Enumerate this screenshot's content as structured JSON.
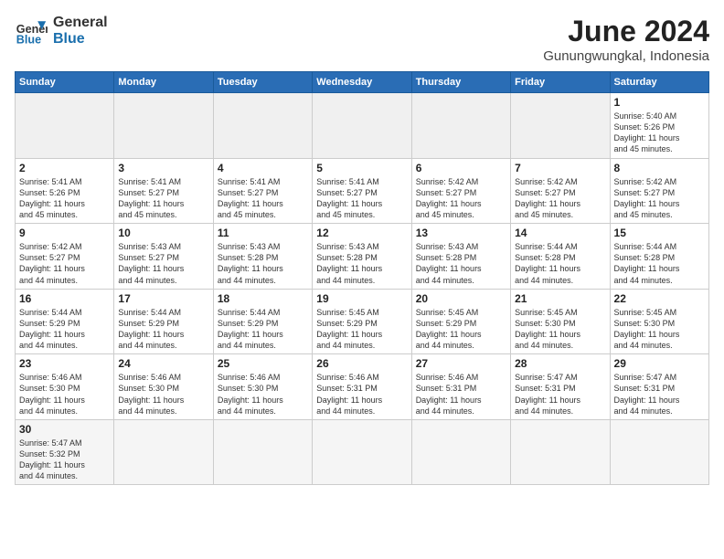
{
  "logo": {
    "line1": "General",
    "line2": "Blue"
  },
  "title": "June 2024",
  "subtitle": "Gunungwungkal, Indonesia",
  "days_of_week": [
    "Sunday",
    "Monday",
    "Tuesday",
    "Wednesday",
    "Thursday",
    "Friday",
    "Saturday"
  ],
  "weeks": [
    [
      {
        "day": "",
        "info": ""
      },
      {
        "day": "",
        "info": ""
      },
      {
        "day": "",
        "info": ""
      },
      {
        "day": "",
        "info": ""
      },
      {
        "day": "",
        "info": ""
      },
      {
        "day": "",
        "info": ""
      },
      {
        "day": "1",
        "info": "Sunrise: 5:40 AM\nSunset: 5:26 PM\nDaylight: 11 hours\nand 45 minutes."
      }
    ],
    [
      {
        "day": "2",
        "info": "Sunrise: 5:41 AM\nSunset: 5:26 PM\nDaylight: 11 hours\nand 45 minutes."
      },
      {
        "day": "3",
        "info": "Sunrise: 5:41 AM\nSunset: 5:27 PM\nDaylight: 11 hours\nand 45 minutes."
      },
      {
        "day": "4",
        "info": "Sunrise: 5:41 AM\nSunset: 5:27 PM\nDaylight: 11 hours\nand 45 minutes."
      },
      {
        "day": "5",
        "info": "Sunrise: 5:41 AM\nSunset: 5:27 PM\nDaylight: 11 hours\nand 45 minutes."
      },
      {
        "day": "6",
        "info": "Sunrise: 5:42 AM\nSunset: 5:27 PM\nDaylight: 11 hours\nand 45 minutes."
      },
      {
        "day": "7",
        "info": "Sunrise: 5:42 AM\nSunset: 5:27 PM\nDaylight: 11 hours\nand 45 minutes."
      },
      {
        "day": "8",
        "info": "Sunrise: 5:42 AM\nSunset: 5:27 PM\nDaylight: 11 hours\nand 45 minutes."
      }
    ],
    [
      {
        "day": "9",
        "info": "Sunrise: 5:42 AM\nSunset: 5:27 PM\nDaylight: 11 hours\nand 44 minutes."
      },
      {
        "day": "10",
        "info": "Sunrise: 5:43 AM\nSunset: 5:27 PM\nDaylight: 11 hours\nand 44 minutes."
      },
      {
        "day": "11",
        "info": "Sunrise: 5:43 AM\nSunset: 5:28 PM\nDaylight: 11 hours\nand 44 minutes."
      },
      {
        "day": "12",
        "info": "Sunrise: 5:43 AM\nSunset: 5:28 PM\nDaylight: 11 hours\nand 44 minutes."
      },
      {
        "day": "13",
        "info": "Sunrise: 5:43 AM\nSunset: 5:28 PM\nDaylight: 11 hours\nand 44 minutes."
      },
      {
        "day": "14",
        "info": "Sunrise: 5:44 AM\nSunset: 5:28 PM\nDaylight: 11 hours\nand 44 minutes."
      },
      {
        "day": "15",
        "info": "Sunrise: 5:44 AM\nSunset: 5:28 PM\nDaylight: 11 hours\nand 44 minutes."
      }
    ],
    [
      {
        "day": "16",
        "info": "Sunrise: 5:44 AM\nSunset: 5:29 PM\nDaylight: 11 hours\nand 44 minutes."
      },
      {
        "day": "17",
        "info": "Sunrise: 5:44 AM\nSunset: 5:29 PM\nDaylight: 11 hours\nand 44 minutes."
      },
      {
        "day": "18",
        "info": "Sunrise: 5:44 AM\nSunset: 5:29 PM\nDaylight: 11 hours\nand 44 minutes."
      },
      {
        "day": "19",
        "info": "Sunrise: 5:45 AM\nSunset: 5:29 PM\nDaylight: 11 hours\nand 44 minutes."
      },
      {
        "day": "20",
        "info": "Sunrise: 5:45 AM\nSunset: 5:29 PM\nDaylight: 11 hours\nand 44 minutes."
      },
      {
        "day": "21",
        "info": "Sunrise: 5:45 AM\nSunset: 5:30 PM\nDaylight: 11 hours\nand 44 minutes."
      },
      {
        "day": "22",
        "info": "Sunrise: 5:45 AM\nSunset: 5:30 PM\nDaylight: 11 hours\nand 44 minutes."
      }
    ],
    [
      {
        "day": "23",
        "info": "Sunrise: 5:46 AM\nSunset: 5:30 PM\nDaylight: 11 hours\nand 44 minutes."
      },
      {
        "day": "24",
        "info": "Sunrise: 5:46 AM\nSunset: 5:30 PM\nDaylight: 11 hours\nand 44 minutes."
      },
      {
        "day": "25",
        "info": "Sunrise: 5:46 AM\nSunset: 5:30 PM\nDaylight: 11 hours\nand 44 minutes."
      },
      {
        "day": "26",
        "info": "Sunrise: 5:46 AM\nSunset: 5:31 PM\nDaylight: 11 hours\nand 44 minutes."
      },
      {
        "day": "27",
        "info": "Sunrise: 5:46 AM\nSunset: 5:31 PM\nDaylight: 11 hours\nand 44 minutes."
      },
      {
        "day": "28",
        "info": "Sunrise: 5:47 AM\nSunset: 5:31 PM\nDaylight: 11 hours\nand 44 minutes."
      },
      {
        "day": "29",
        "info": "Sunrise: 5:47 AM\nSunset: 5:31 PM\nDaylight: 11 hours\nand 44 minutes."
      }
    ],
    [
      {
        "day": "30",
        "info": "Sunrise: 5:47 AM\nSunset: 5:32 PM\nDaylight: 11 hours\nand 44 minutes."
      },
      {
        "day": "",
        "info": ""
      },
      {
        "day": "",
        "info": ""
      },
      {
        "day": "",
        "info": ""
      },
      {
        "day": "",
        "info": ""
      },
      {
        "day": "",
        "info": ""
      },
      {
        "day": "",
        "info": ""
      }
    ]
  ]
}
